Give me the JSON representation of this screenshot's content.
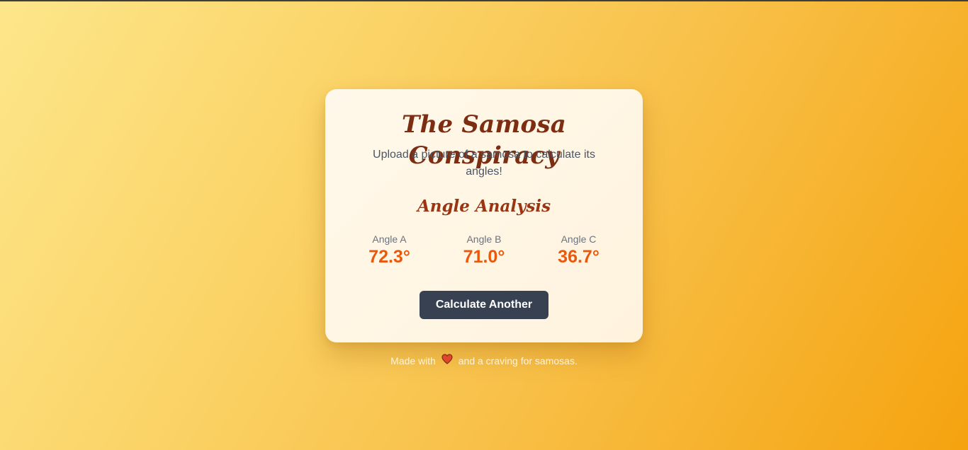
{
  "app": {
    "title": "The Samosa Conspiracy",
    "subtitle": "Upload a picture of a samosa to calculate its angles!"
  },
  "analysis": {
    "heading": "Angle Analysis",
    "angles": [
      {
        "label": "Angle A",
        "value": "72.3°"
      },
      {
        "label": "Angle B",
        "value": "71.0°"
      },
      {
        "label": "Angle C",
        "value": "36.7°"
      }
    ]
  },
  "actions": {
    "calculate_again_label": "Calculate Another"
  },
  "footer": {
    "before_icon": "Made with",
    "icon": "heart-icon",
    "after_icon": "and a craving for samosas."
  },
  "colors": {
    "title": "#7c2d12",
    "section_title": "#9a3412",
    "angle_value": "#ea580c",
    "button_bg": "#374151",
    "heart": "#e0462c"
  }
}
